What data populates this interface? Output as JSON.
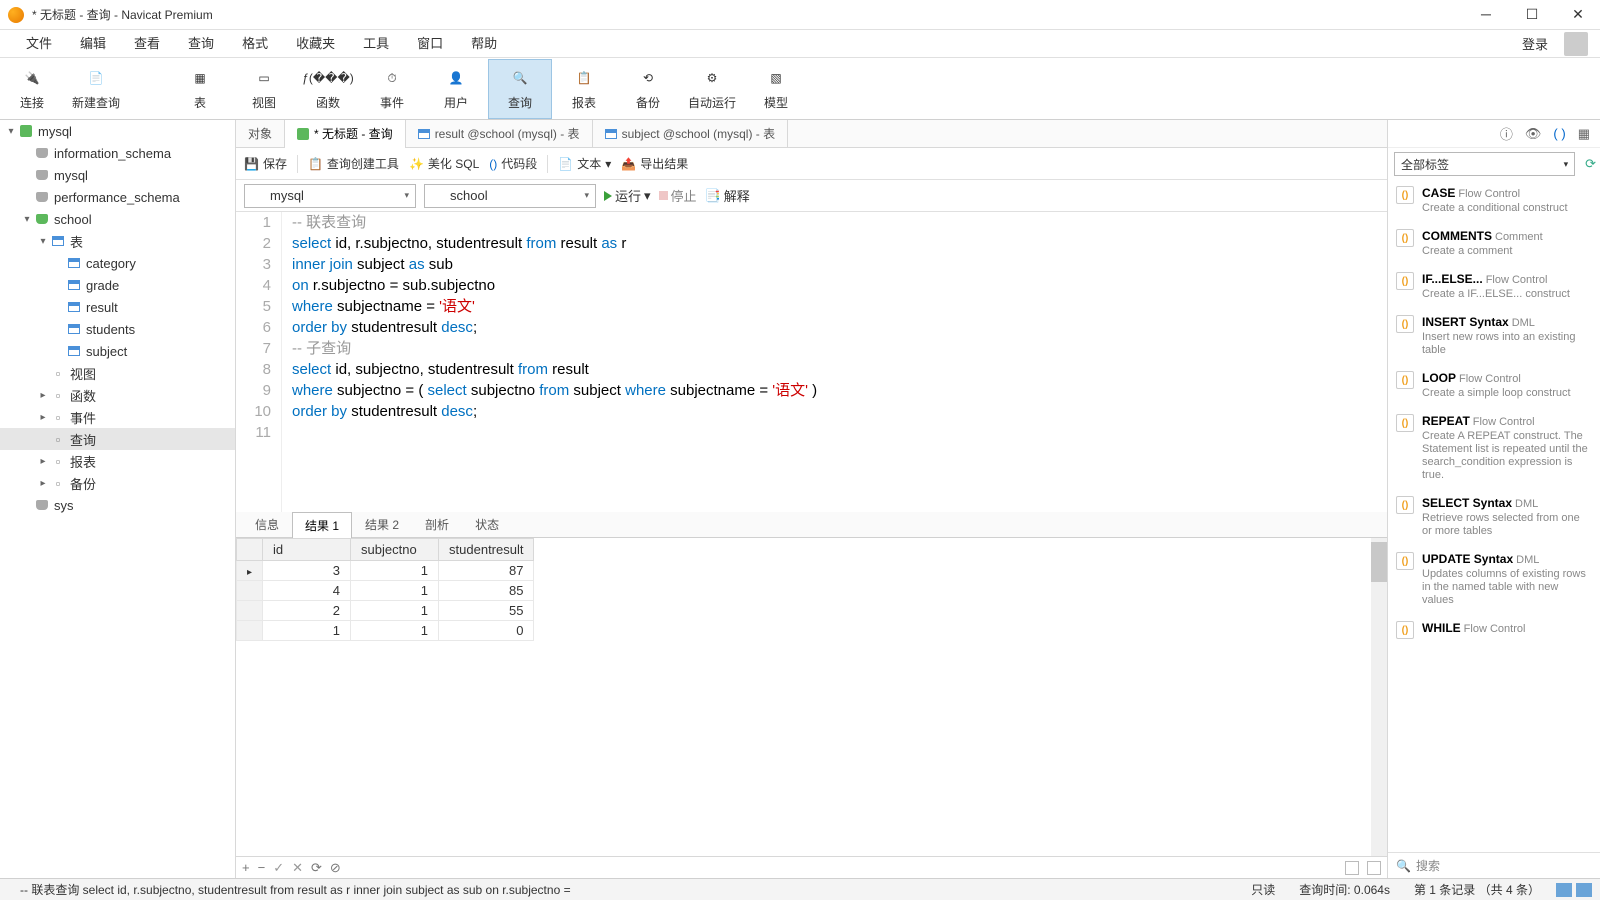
{
  "window": {
    "title": "* 无标题 - 查询 - Navicat Premium"
  },
  "menubar": {
    "items": [
      "文件",
      "编辑",
      "查看",
      "查询",
      "格式",
      "收藏夹",
      "工具",
      "窗口",
      "帮助"
    ],
    "login": "登录"
  },
  "toolbar": {
    "items": [
      {
        "label": "连接",
        "icon": "plug"
      },
      {
        "label": "新建查询",
        "icon": "new-query"
      },
      {
        "label": "表",
        "icon": "table"
      },
      {
        "label": "视图",
        "icon": "view"
      },
      {
        "label": "函数",
        "icon": "fx"
      },
      {
        "label": "事件",
        "icon": "clock"
      },
      {
        "label": "用户",
        "icon": "user"
      },
      {
        "label": "查询",
        "icon": "query",
        "active": true
      },
      {
        "label": "报表",
        "icon": "report"
      },
      {
        "label": "备份",
        "icon": "backup"
      },
      {
        "label": "自动运行",
        "icon": "auto"
      },
      {
        "label": "模型",
        "icon": "model"
      }
    ]
  },
  "sidebar": {
    "rows": [
      {
        "indent": 0,
        "tw": "▾",
        "icon": "conn",
        "label": "mysql"
      },
      {
        "indent": 1,
        "tw": "",
        "icon": "db",
        "label": "information_schema"
      },
      {
        "indent": 1,
        "tw": "",
        "icon": "db",
        "label": "mysql"
      },
      {
        "indent": 1,
        "tw": "",
        "icon": "db",
        "label": "performance_schema"
      },
      {
        "indent": 1,
        "tw": "▾",
        "icon": "db-open",
        "label": "school"
      },
      {
        "indent": 2,
        "tw": "▾",
        "icon": "tbl",
        "label": "表"
      },
      {
        "indent": 3,
        "tw": "",
        "icon": "tbl",
        "label": "category"
      },
      {
        "indent": 3,
        "tw": "",
        "icon": "tbl",
        "label": "grade"
      },
      {
        "indent": 3,
        "tw": "",
        "icon": "tbl",
        "label": "result"
      },
      {
        "indent": 3,
        "tw": "",
        "icon": "tbl",
        "label": "students"
      },
      {
        "indent": 3,
        "tw": "",
        "icon": "tbl",
        "label": "subject"
      },
      {
        "indent": 2,
        "tw": "",
        "icon": "view",
        "label": "视图"
      },
      {
        "indent": 2,
        "tw": "▸",
        "icon": "fx",
        "label": "函数"
      },
      {
        "indent": 2,
        "tw": "▸",
        "icon": "evt",
        "label": "事件"
      },
      {
        "indent": 2,
        "tw": "",
        "icon": "qry",
        "label": "查询",
        "selected": true
      },
      {
        "indent": 2,
        "tw": "▸",
        "icon": "rpt",
        "label": "报表"
      },
      {
        "indent": 2,
        "tw": "▸",
        "icon": "bak",
        "label": "备份"
      },
      {
        "indent": 1,
        "tw": "",
        "icon": "db",
        "label": "sys"
      }
    ]
  },
  "tabs": [
    {
      "label": "对象",
      "active": false
    },
    {
      "label": "* 无标题 - 查询",
      "active": true,
      "icon": "conn"
    },
    {
      "label": "result @school (mysql) - 表",
      "active": false,
      "icon": "tbl"
    },
    {
      "label": "subject @school (mysql) - 表",
      "active": false,
      "icon": "tbl"
    }
  ],
  "query_toolbar": {
    "save": "保存",
    "builder": "查询创建工具",
    "beautify": "美化 SQL",
    "snippet": "代码段",
    "text": "文本",
    "export": "导出结果"
  },
  "conn_row": {
    "conn": "mysql",
    "db": "school",
    "run": "运行",
    "stop": "停止",
    "explain": "解释"
  },
  "editor": {
    "lines": [
      [
        {
          "t": "-- ",
          "c": "cm"
        },
        {
          "t": "联表查询",
          "c": "cm"
        }
      ],
      [
        {
          "t": "select",
          "c": "kw"
        },
        {
          "t": " id, r.subjectno, studentresult "
        },
        {
          "t": "from",
          "c": "kw"
        },
        {
          "t": " result "
        },
        {
          "t": "as",
          "c": "kw"
        },
        {
          "t": " r"
        }
      ],
      [
        {
          "t": "inner join",
          "c": "kw"
        },
        {
          "t": " subject "
        },
        {
          "t": "as",
          "c": "kw"
        },
        {
          "t": " sub"
        }
      ],
      [
        {
          "t": "on",
          "c": "kw"
        },
        {
          "t": " r.subjectno = sub.subjectno"
        }
      ],
      [
        {
          "t": "where",
          "c": "kw"
        },
        {
          "t": " subjectname = "
        },
        {
          "t": "'语文'",
          "c": "str"
        }
      ],
      [
        {
          "t": "order by",
          "c": "kw"
        },
        {
          "t": " studentresult "
        },
        {
          "t": "desc",
          "c": "kw"
        },
        {
          "t": ";"
        }
      ],
      [
        {
          "t": ""
        }
      ],
      [
        {
          "t": "-- ",
          "c": "cm"
        },
        {
          "t": "子查询",
          "c": "cm"
        }
      ],
      [
        {
          "t": "select",
          "c": "kw"
        },
        {
          "t": " id, subjectno, studentresult "
        },
        {
          "t": "from",
          "c": "kw"
        },
        {
          "t": " result"
        }
      ],
      [
        {
          "t": "where",
          "c": "kw"
        },
        {
          "t": " subjectno = ( "
        },
        {
          "t": "select",
          "c": "kw"
        },
        {
          "t": " subjectno "
        },
        {
          "t": "from",
          "c": "kw"
        },
        {
          "t": " subject "
        },
        {
          "t": "where",
          "c": "kw"
        },
        {
          "t": " subjectname = "
        },
        {
          "t": "'语文'",
          "c": "str"
        },
        {
          "t": " )"
        }
      ],
      [
        {
          "t": "order by",
          "c": "kw"
        },
        {
          "t": " studentresult "
        },
        {
          "t": "desc",
          "c": "kw"
        },
        {
          "t": ";"
        }
      ]
    ]
  },
  "result_tabs": [
    "信息",
    "结果 1",
    "结果 2",
    "剖析",
    "状态"
  ],
  "result_tabs_active": 1,
  "grid": {
    "columns": [
      "id",
      "subjectno",
      "studentresult"
    ],
    "rows": [
      {
        "ptr": true,
        "cells": [
          "3",
          "1",
          "87"
        ]
      },
      {
        "ptr": false,
        "cells": [
          "4",
          "1",
          "85"
        ]
      },
      {
        "ptr": false,
        "cells": [
          "2",
          "1",
          "55"
        ]
      },
      {
        "ptr": false,
        "cells": [
          "1",
          "1",
          "0"
        ]
      }
    ]
  },
  "grid_sb": {
    "plus": "+",
    "minus": "−",
    "check": "✓",
    "refresh": "⟳",
    "stop": "⊘"
  },
  "right": {
    "tag_filter": "全部标签",
    "snippets": [
      {
        "title": "CASE",
        "tag": "Flow Control",
        "desc": "Create a conditional construct"
      },
      {
        "title": "COMMENTS",
        "tag": "Comment",
        "desc": "Create a comment"
      },
      {
        "title": "IF...ELSE...",
        "tag": "Flow Control",
        "desc": "Create a IF...ELSE... construct"
      },
      {
        "title": "INSERT Syntax",
        "tag": "DML",
        "desc": "Insert new rows into an existing table"
      },
      {
        "title": "LOOP",
        "tag": "Flow Control",
        "desc": "Create a simple loop construct"
      },
      {
        "title": "REPEAT",
        "tag": "Flow Control",
        "desc": "Create A REPEAT construct. The Statement list is repeated until the search_condition expression is true."
      },
      {
        "title": "SELECT Syntax",
        "tag": "DML",
        "desc": "Retrieve rows selected from one or more tables"
      },
      {
        "title": "UPDATE Syntax",
        "tag": "DML",
        "desc": "Updates columns of existing rows in the named table with new values"
      },
      {
        "title": "WHILE",
        "tag": "Flow Control",
        "desc": ""
      }
    ],
    "search": "搜索"
  },
  "statusbar": {
    "sql": "-- 联表查询 select id, r.subjectno, studentresult from result as r inner join subject as sub on r.subjectno =",
    "readonly": "只读",
    "time": "查询时间: 0.064s",
    "records": "第 1 条记录 （共 4 条）"
  }
}
